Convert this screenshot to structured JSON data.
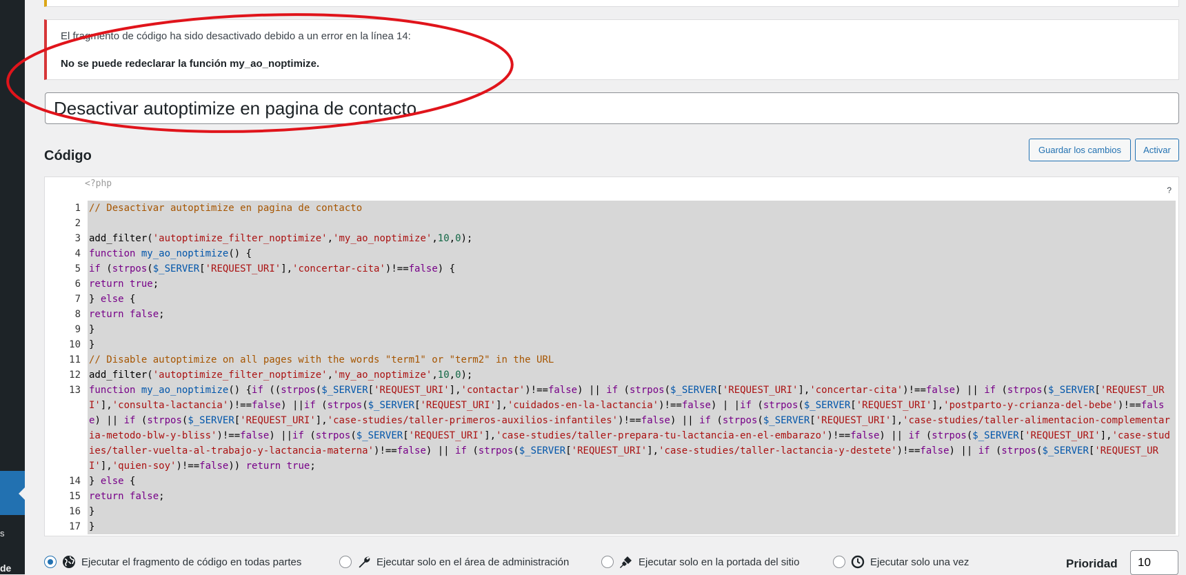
{
  "notice": {
    "message": "El fragmento de código ha sido desactivado debido a un error en la línea 14:",
    "detail": "No se puede redeclarar la función my_ao_noptimize."
  },
  "snippet": {
    "title": "Desactivar autoptimize en pagina de contacto"
  },
  "code_section": {
    "heading": "Código",
    "save_label": "Guardar los cambios",
    "activate_label": "Activar",
    "php_open": "<?php",
    "help": "?",
    "line_numbers": [
      "1",
      "2",
      "3",
      "4",
      "5",
      "6",
      "7",
      "8",
      "9",
      "10",
      "11",
      "12",
      "13",
      "14",
      "15",
      "16",
      "17"
    ]
  },
  "run": {
    "everywhere": "Ejecutar el fragmento de código en todas partes",
    "admin": "Ejecutar solo en el área de administración",
    "frontend": "Ejecutar solo en la portada del sitio",
    "once": "Ejecutar solo una vez",
    "selected": "everywhere"
  },
  "priority": {
    "label": "Prioridad",
    "value": "10"
  },
  "sidebar": {
    "text_1": "s",
    "text_2": "de"
  },
  "colors": {
    "error": "#d63638",
    "warning": "#dba617",
    "accent": "#2271b1",
    "annotation": "#e0141b"
  },
  "icons": {
    "everywhere": "globe-icon",
    "admin": "wrench-icon",
    "frontend": "brush-icon",
    "once": "clock-icon"
  }
}
